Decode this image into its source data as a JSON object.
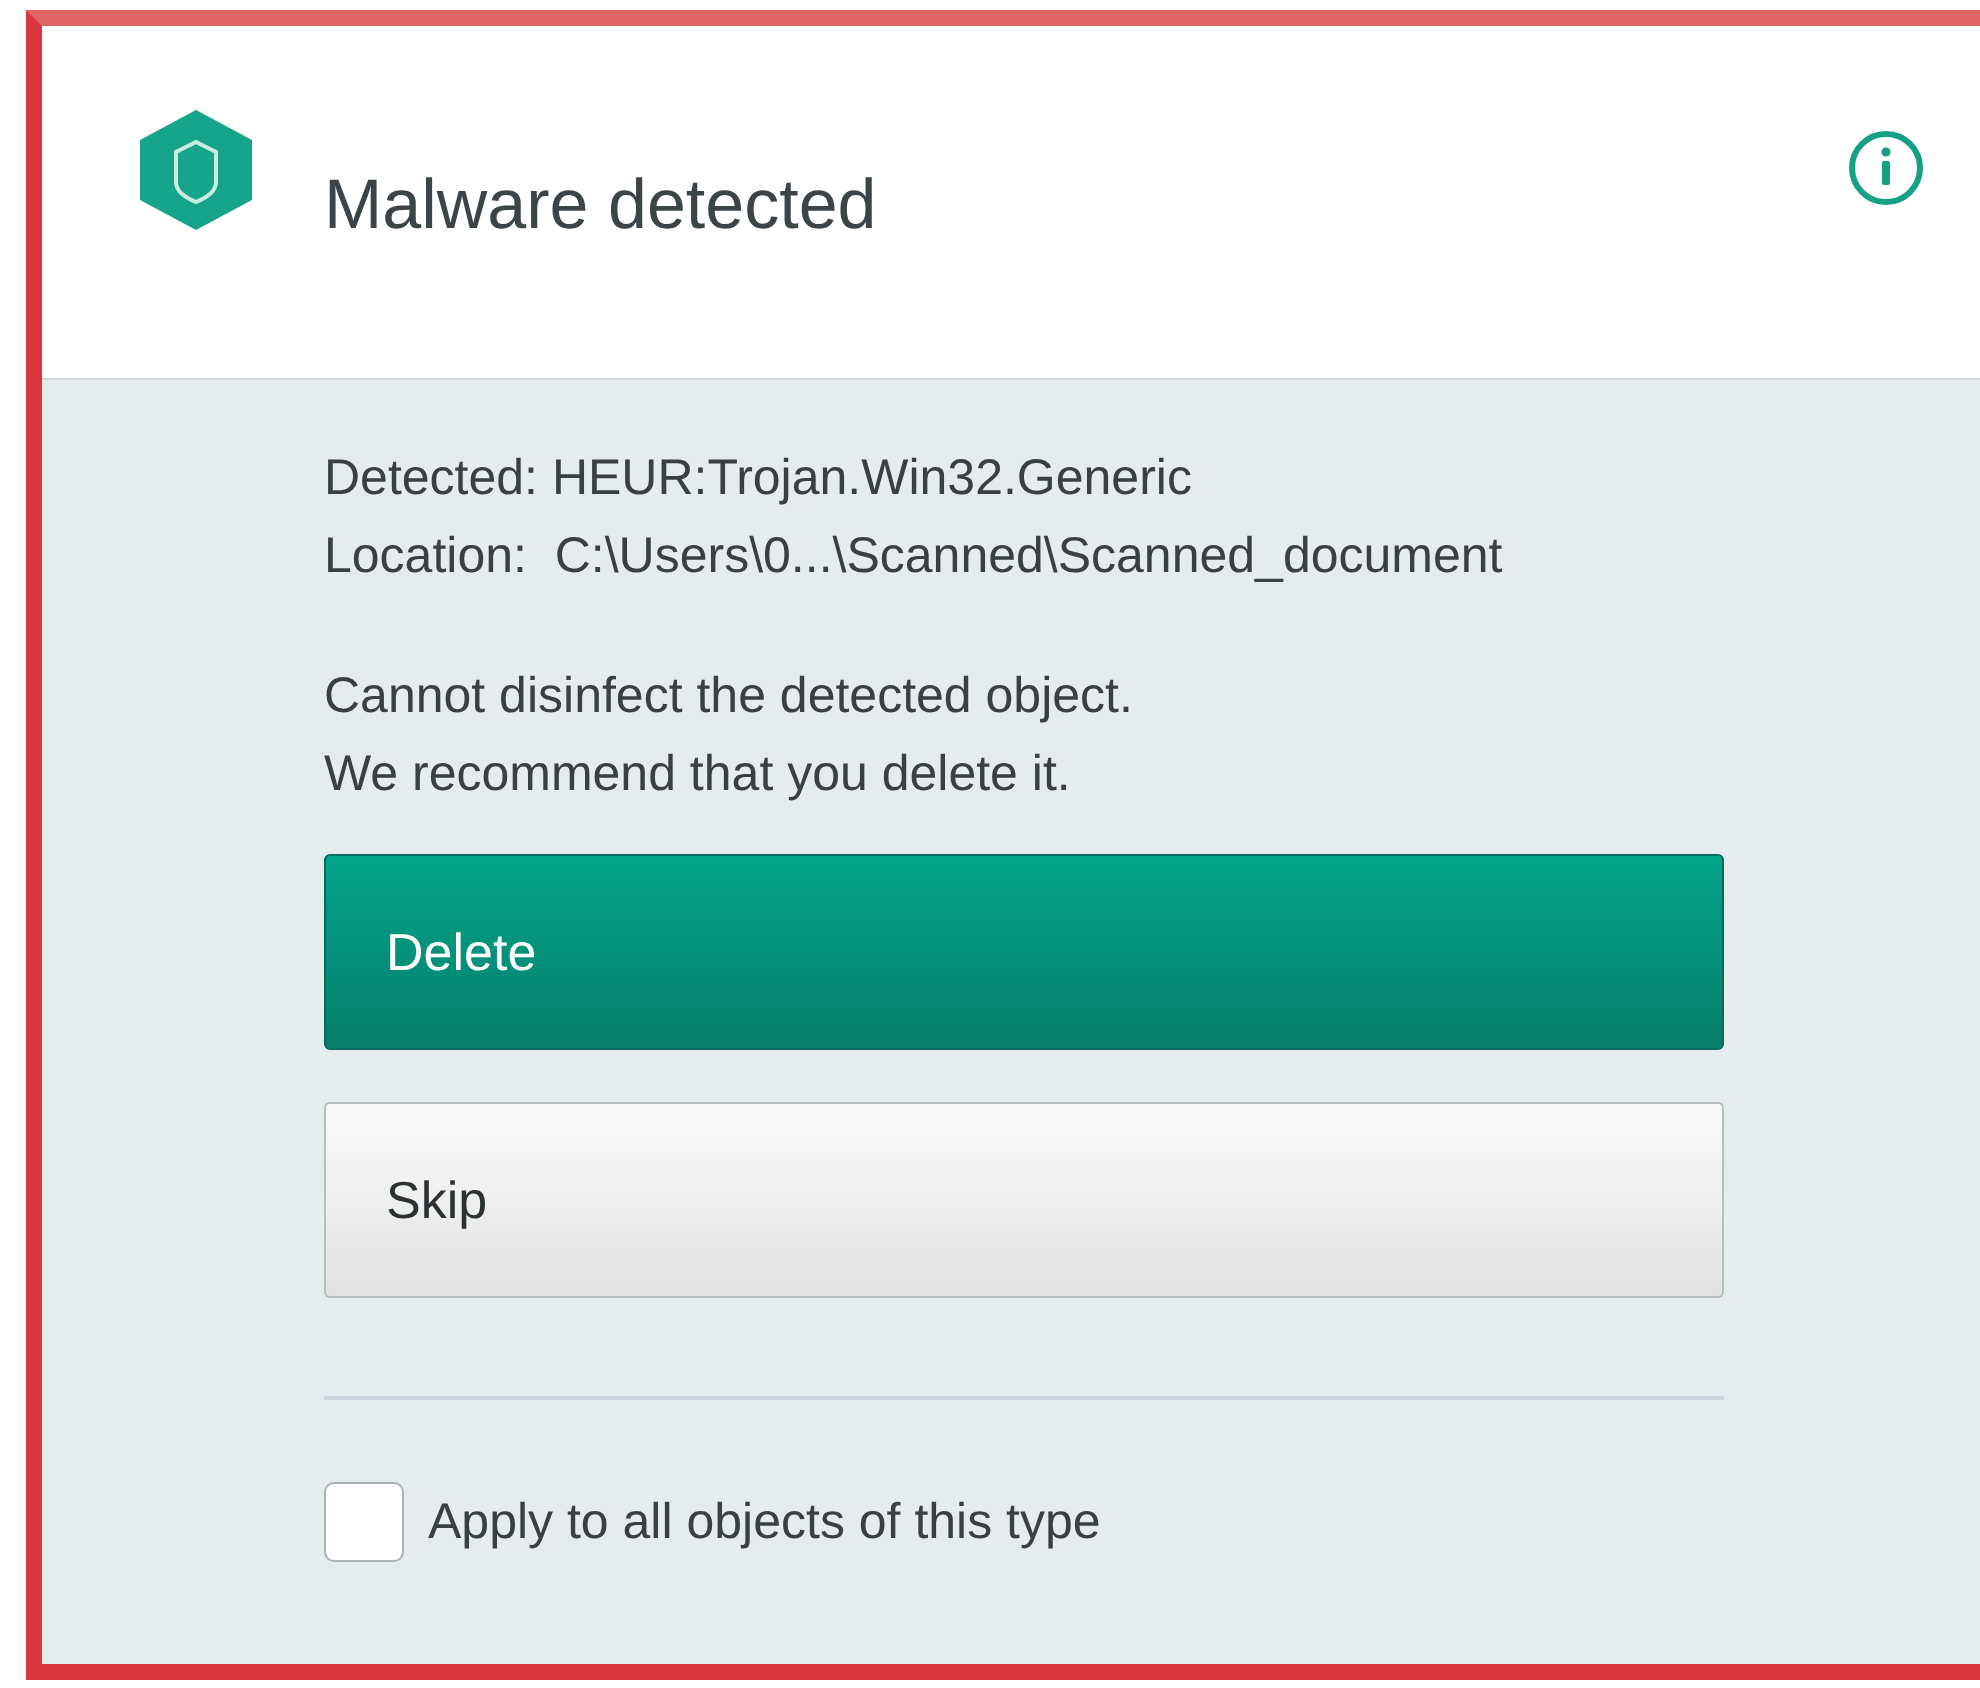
{
  "dialog": {
    "title": "Malware detected"
  },
  "details": [
    "Detected: HEUR:Trojan.Win32.Generic",
    "Location:  C:\\Users\\0...\\Scanned\\Scanned_document"
  ],
  "message": [
    "Cannot disinfect the detected object.",
    "We recommend that you delete it."
  ],
  "buttons": [
    {
      "label": "Delete",
      "kind": "primary"
    },
    {
      "label": "Skip",
      "kind": "secondary"
    }
  ],
  "apply_all": {
    "label": "Apply to all objects of this type",
    "checked": false
  }
}
